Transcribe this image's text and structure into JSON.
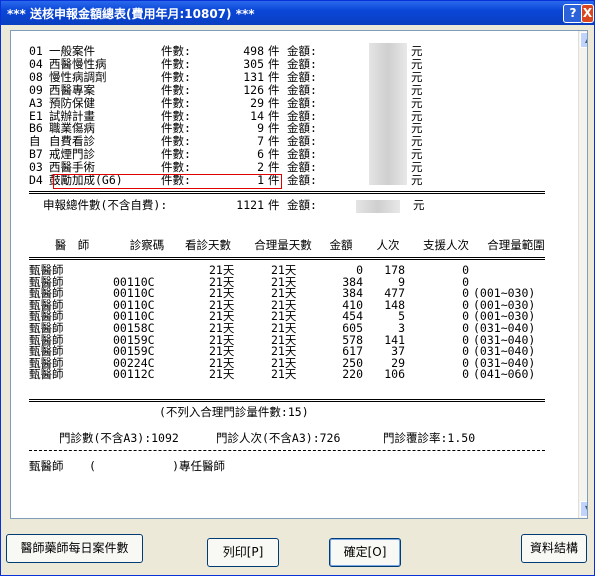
{
  "window": {
    "title": "*** 送核申報金額總表(費用年月:10807) ***",
    "help_label": "?",
    "close_label": "X"
  },
  "summary": {
    "rows": [
      {
        "code": "01",
        "name": "一般案件",
        "count_label": "件數:",
        "count": "498",
        "unit": "件",
        "amount_label": "金額:",
        "currency": "元"
      },
      {
        "code": "04",
        "name": "西醫慢性病",
        "count_label": "件數:",
        "count": "305",
        "unit": "件",
        "amount_label": "金額:",
        "currency": "元"
      },
      {
        "code": "08",
        "name": "慢性病調劑",
        "count_label": "件數:",
        "count": "131",
        "unit": "件",
        "amount_label": "金額:",
        "currency": "元"
      },
      {
        "code": "09",
        "name": "西醫專案",
        "count_label": "件數:",
        "count": "126",
        "unit": "件",
        "amount_label": "金額:",
        "currency": "元"
      },
      {
        "code": "A3",
        "name": "預防保健",
        "count_label": "件數:",
        "count": "29",
        "unit": "件",
        "amount_label": "金額:",
        "currency": "元"
      },
      {
        "code": "E1",
        "name": "試辦計畫",
        "count_label": "件數:",
        "count": "14",
        "unit": "件",
        "amount_label": "金額:",
        "currency": "元"
      },
      {
        "code": "B6",
        "name": "職業傷病",
        "count_label": "件數:",
        "count": "9",
        "unit": "件",
        "amount_label": "金額:",
        "currency": "元"
      },
      {
        "code": "自",
        "name": "自費看診",
        "count_label": "件數:",
        "count": "7",
        "unit": "件",
        "amount_label": "金額:",
        "currency": "元"
      },
      {
        "code": "B7",
        "name": "戒煙門診",
        "count_label": "件數:",
        "count": "6",
        "unit": "件",
        "amount_label": "金額:",
        "currency": "元"
      },
      {
        "code": "03",
        "name": "西醫手術",
        "count_label": "件數:",
        "count": "2",
        "unit": "件",
        "amount_label": "金額:",
        "currency": "元"
      },
      {
        "code": "D4",
        "name": "鼓勵加成(G6)",
        "count_label": "件數:",
        "count": "1",
        "unit": "件",
        "amount_label": "金額:",
        "currency": "元"
      }
    ],
    "total": {
      "label": "申報總件數(不含自費):",
      "count": "1121",
      "unit": "件",
      "amount_label": "金額:",
      "currency": "元"
    }
  },
  "doctor_table": {
    "headers": [
      "醫　師",
      "診察碼",
      "看診天數",
      "合理量天數",
      "金額",
      "人次",
      "支援人次",
      "合理量範圍"
    ],
    "rows": [
      {
        "doctor": "甄醫師",
        "code": "",
        "days": "21天",
        "reasonable_days": "21天",
        "amount": "0",
        "visits": "178",
        "support": "0",
        "range": ""
      },
      {
        "doctor": "甄醫師",
        "code": "00110C",
        "days": "21天",
        "reasonable_days": "21天",
        "amount": "384",
        "visits": "9",
        "support": "0",
        "range": ""
      },
      {
        "doctor": "甄醫師",
        "code": "00110C",
        "days": "21天",
        "reasonable_days": "21天",
        "amount": "384",
        "visits": "477",
        "support": "0",
        "range": "(001~030)"
      },
      {
        "doctor": "甄醫師",
        "code": "00110C",
        "days": "21天",
        "reasonable_days": "21天",
        "amount": "410",
        "visits": "148",
        "support": "0",
        "range": "(001~030)"
      },
      {
        "doctor": "甄醫師",
        "code": "00110C",
        "days": "21天",
        "reasonable_days": "21天",
        "amount": "454",
        "visits": "5",
        "support": "0",
        "range": "(001~030)"
      },
      {
        "doctor": "甄醫師",
        "code": "00158C",
        "days": "21天",
        "reasonable_days": "21天",
        "amount": "605",
        "visits": "3",
        "support": "0",
        "range": "(031~040)"
      },
      {
        "doctor": "甄醫師",
        "code": "00159C",
        "days": "21天",
        "reasonable_days": "21天",
        "amount": "578",
        "visits": "141",
        "support": "0",
        "range": "(031~040)"
      },
      {
        "doctor": "甄醫師",
        "code": "00159C",
        "days": "21天",
        "reasonable_days": "21天",
        "amount": "617",
        "visits": "37",
        "support": "0",
        "range": "(031~040)"
      },
      {
        "doctor": "甄醫師",
        "code": "00224C",
        "days": "21天",
        "reasonable_days": "21天",
        "amount": "250",
        "visits": "29",
        "support": "0",
        "range": "(031~040)"
      },
      {
        "doctor": "甄醫師",
        "code": "00112C",
        "days": "21天",
        "reasonable_days": "21天",
        "amount": "220",
        "visits": "106",
        "support": "0",
        "range": "(041~060)"
      }
    ],
    "note": "(不列入合理門診量件數:15)",
    "stats": {
      "outpatient": "門診數(不含A3):1092",
      "visits": "門診人次(不含A3):726",
      "revisit": "門診覆診率:1.50"
    },
    "attending": {
      "doctor": "甄醫師",
      "paren": "(           )專任醫師"
    }
  },
  "buttons": {
    "daily": "醫師藥師每日案件數",
    "print": "列印[P]",
    "ok": "確定[O]",
    "settle": "資料結構"
  },
  "scroll": {
    "up_icon": "▲",
    "down_icon": "▼"
  }
}
